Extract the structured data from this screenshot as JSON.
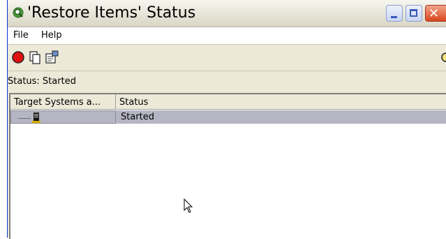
{
  "window": {
    "title": "'Restore Items' Status",
    "controls": {
      "minimize": "minimize-button",
      "maximize": "maximize-button",
      "close": "close-button"
    }
  },
  "menu": {
    "file": "File",
    "help": "Help"
  },
  "toolbar": {
    "icons": [
      "stop-icon",
      "copy-icon",
      "properties-icon"
    ]
  },
  "status_line": "Status: Started",
  "table": {
    "columns": [
      "Target Systems a...",
      "Status"
    ],
    "rows": [
      {
        "target_icon": "system-icon",
        "status": "Started"
      }
    ]
  },
  "colors": {
    "title_bar": "#e8e6d9",
    "close_button": "#d8461f",
    "selected_row": "#b5b5c3"
  }
}
